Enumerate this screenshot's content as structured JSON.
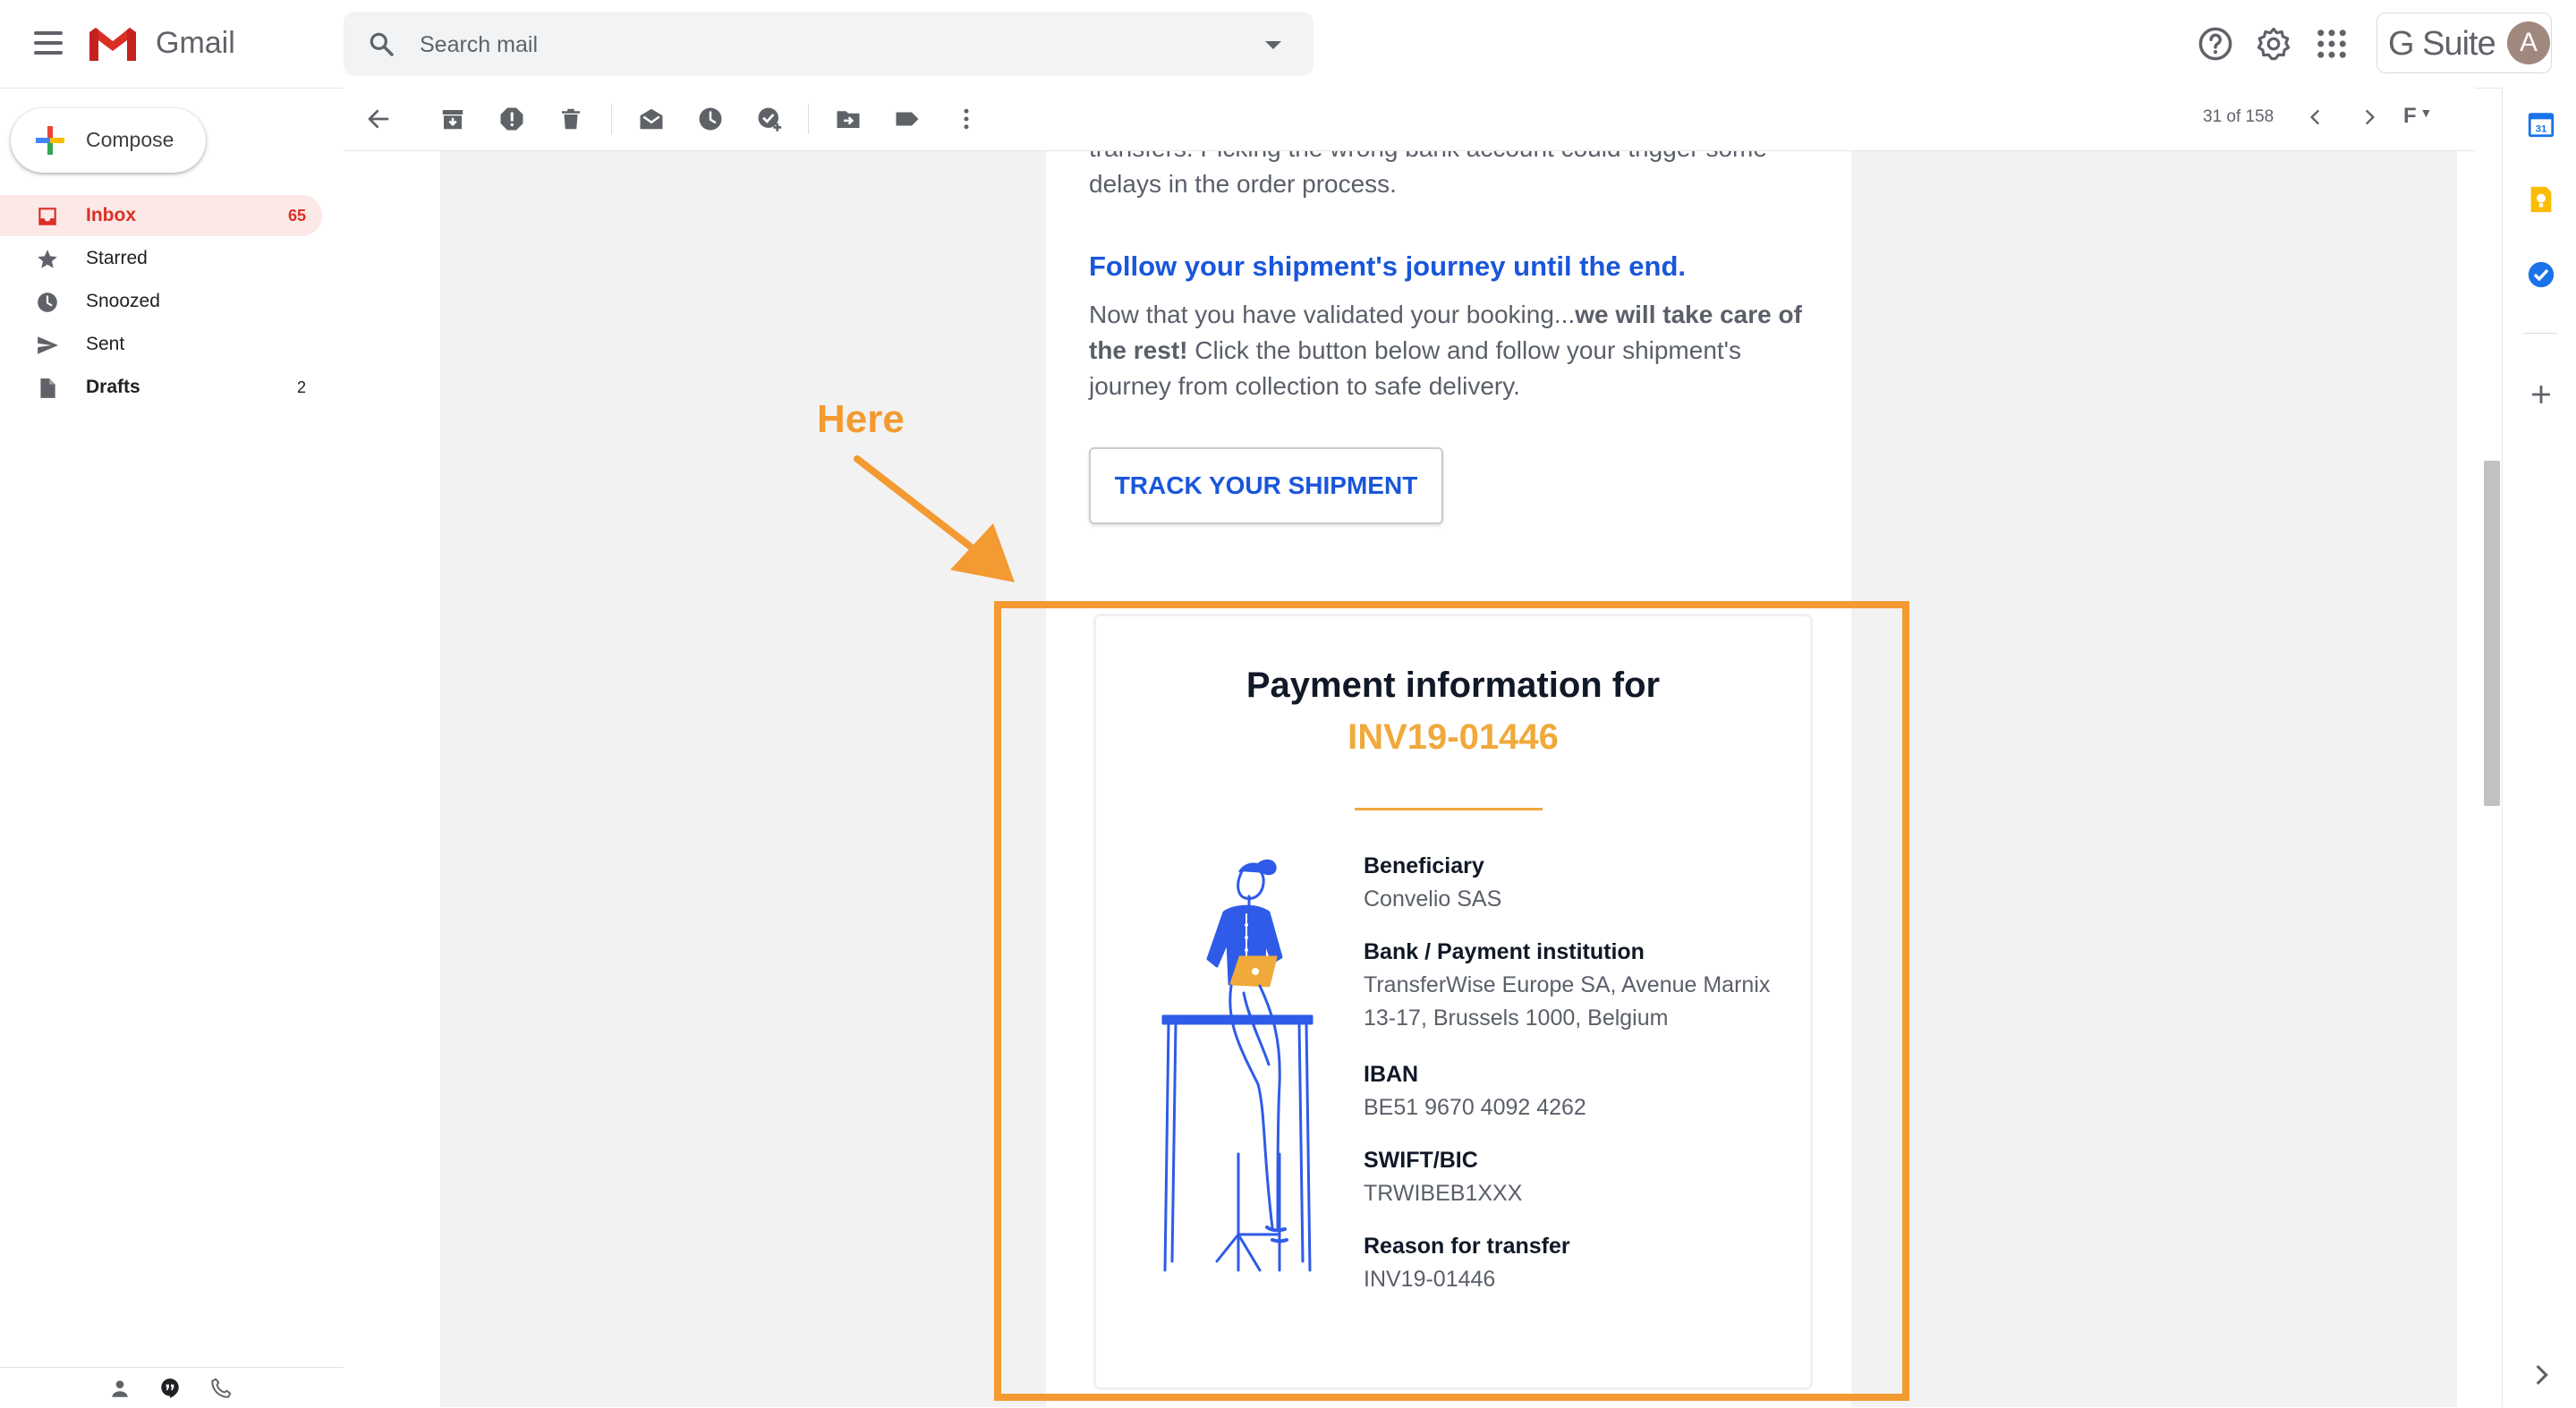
{
  "app": {
    "name": "Gmail",
    "brand_color": "#d93025",
    "suite_label": "G Suite",
    "avatar_initial": "A"
  },
  "search": {
    "placeholder": "Search mail"
  },
  "compose": {
    "label": "Compose"
  },
  "nav": [
    {
      "name": "inbox",
      "label": "Inbox",
      "count": "65",
      "icon": "inbox-icon",
      "active": true
    },
    {
      "name": "starred",
      "label": "Starred",
      "count": "",
      "icon": "star-icon"
    },
    {
      "name": "snoozed",
      "label": "Snoozed",
      "count": "",
      "icon": "clock-icon"
    },
    {
      "name": "sent",
      "label": "Sent",
      "count": "",
      "icon": "send-icon"
    },
    {
      "name": "drafts",
      "label": "Drafts",
      "count": "2",
      "icon": "draft-icon"
    }
  ],
  "toolbar": {
    "icons": [
      "back-arrow-icon",
      "archive-icon",
      "report-spam-icon",
      "delete-icon",
      "mark-unread-icon",
      "snooze-icon",
      "add-task-icon",
      "move-to-icon",
      "label-icon",
      "more-vertical-icon"
    ],
    "pagination": "31 of 158",
    "language_icon": "F"
  },
  "email": {
    "intro_partial_line1": "transfers. Picking the wrong bank account could trigger some",
    "intro_partial_line2": "delays in the order process.",
    "heading": "Follow your shipment's journey until the end.",
    "para_normal_1": "Now that you have validated your booking...",
    "para_bold": "we will take care of the rest!",
    "para_normal_2": " Click the button below and follow your shipment's journey from collection to safe delivery.",
    "button_label": "TRACK YOUR SHIPMENT",
    "accent_color": "#1a56db"
  },
  "payment": {
    "title": "Payment information for",
    "invoice": "INV19-01446",
    "invoice_color": "#f0a93b",
    "fields": [
      {
        "label": "Beneficiary",
        "value": "Convelio SAS"
      },
      {
        "label": "Bank / Payment institution",
        "value": "TransferWise Europe SA, Avenue Marnix 13-17, Brussels 1000, Belgium"
      },
      {
        "label": "IBAN",
        "value": "BE51 9670 4092 4262"
      },
      {
        "label": "SWIFT/BIC",
        "value": "TRWIBEB1XXX"
      },
      {
        "label": "Reason for transfer",
        "value": "INV19-01446"
      }
    ]
  },
  "annotation": {
    "label": "Here",
    "color": "#f39a32"
  },
  "right_panel": {
    "icons": [
      "calendar-icon",
      "keep-icon",
      "tasks-icon",
      "add-addon-icon",
      "expand-panel-icon"
    ],
    "calendar_day": "31"
  }
}
